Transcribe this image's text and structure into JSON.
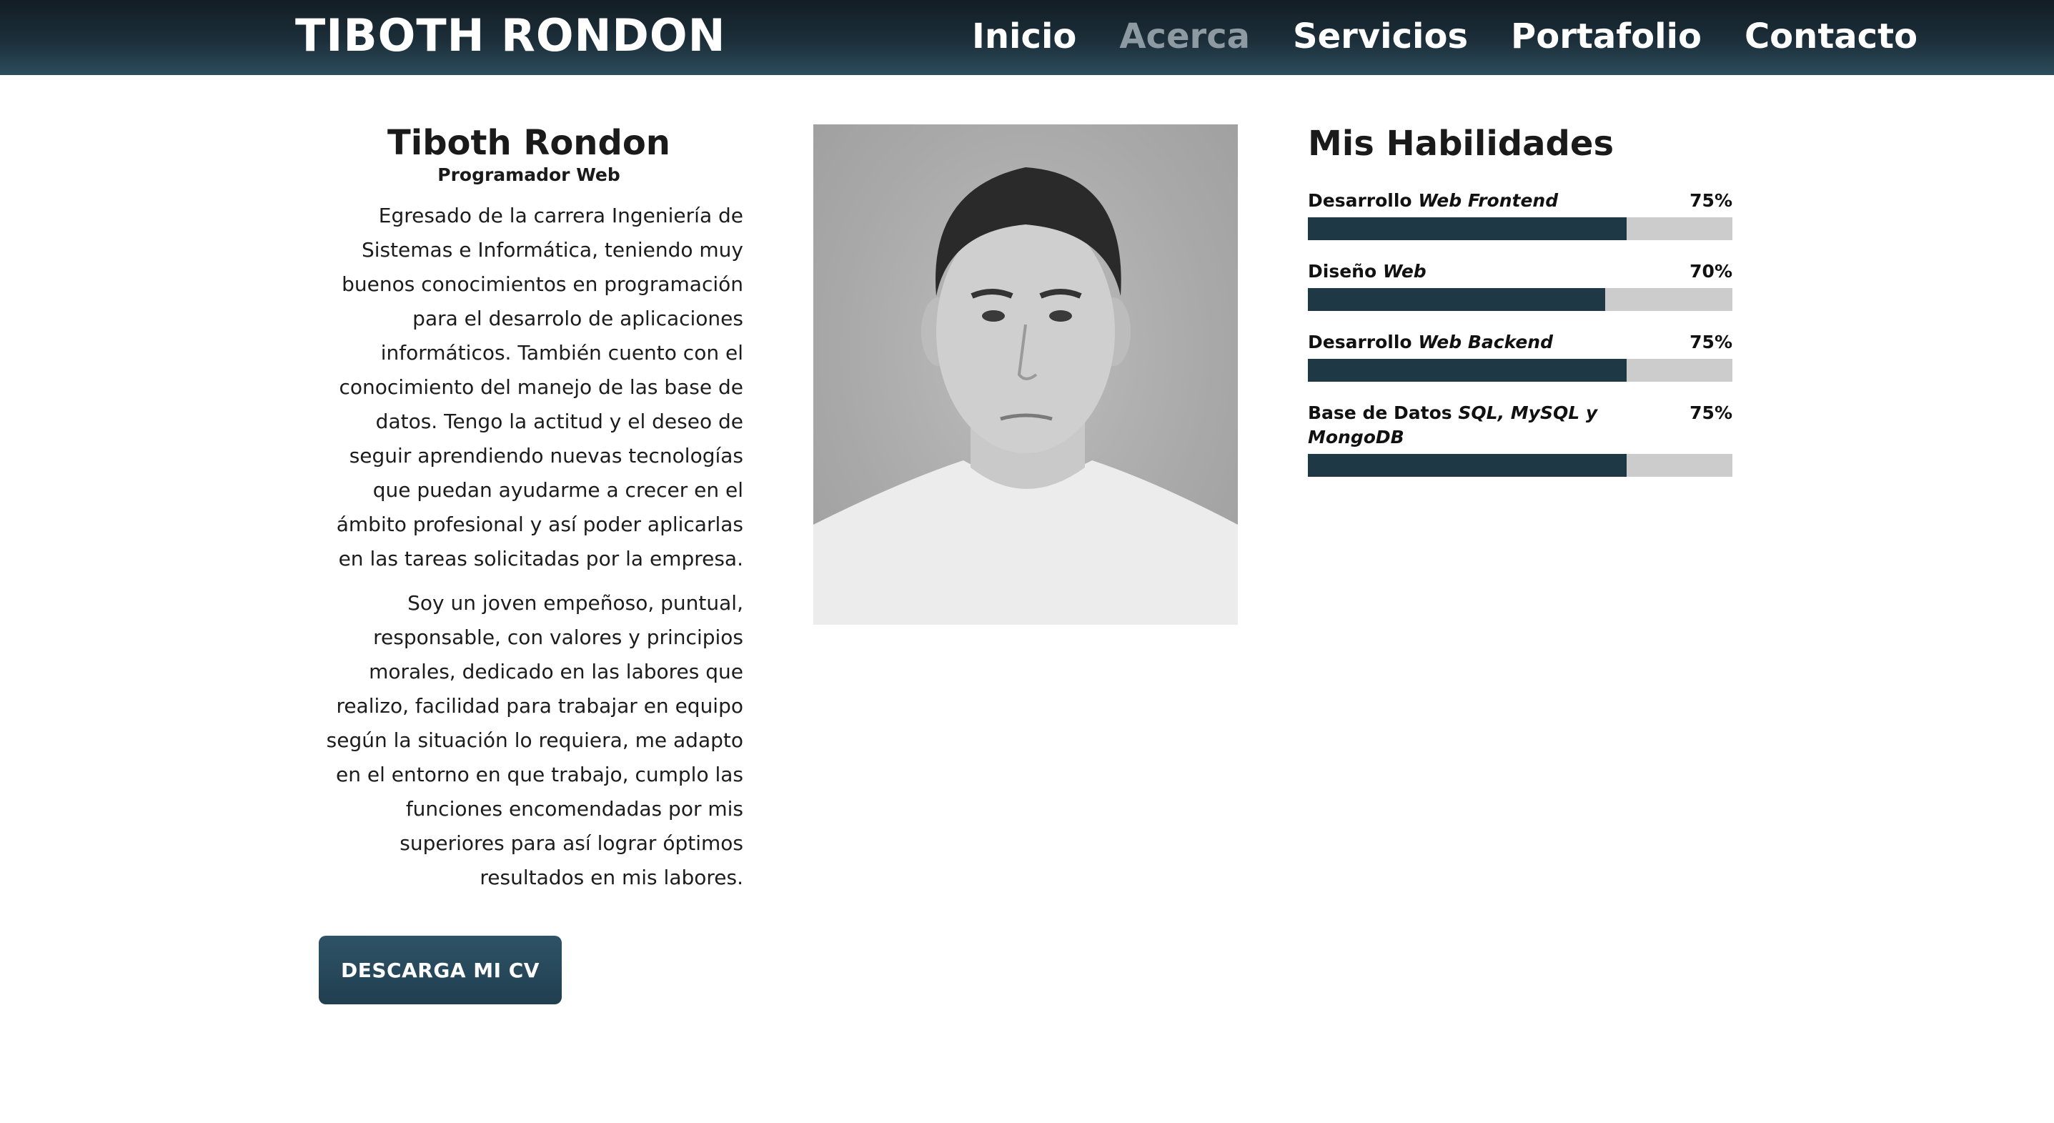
{
  "header": {
    "brand": "TIBOTH RONDON",
    "nav": [
      "Inicio",
      "Acerca",
      "Servicios",
      "Portafolio",
      "Contacto"
    ],
    "active_nav": "Acerca"
  },
  "about": {
    "name": "Tiboth Rondon",
    "role": "Programador Web",
    "paragraph_1": "Egresado de la carrera Ingeniería de Sistemas e Informática, teniendo muy buenos conocimientos en programación para el desarrolo de aplicaciones informáticos. También cuento con el conocimiento del manejo de las base de datos. Tengo la actitud y el deseo de seguir aprendiendo nuevas tecnologías que puedan ayudarme a crecer en el ámbito profesional y así poder aplicarlas en las tareas solicitadas por la empresa.",
    "paragraph_2": "Soy un joven empeñoso, puntual, responsable, con valores y principios morales, dedicado en las labores que realizo, facilidad para trabajar en equipo según la situación lo requiera, me adapto en el entorno en que trabajo, cumplo las funciones encomendadas por mis superiores para así lograr óptimos resultados en mis labores.",
    "cv_button": "DESCARGA MI CV"
  },
  "skills": {
    "title": "Mis Habilidades",
    "items": [
      {
        "label": "Desarrollo",
        "label_em": "Web Frontend",
        "percent_text": "75%",
        "percent": 75
      },
      {
        "label": "Diseño",
        "label_em": "Web",
        "percent_text": "70%",
        "percent": 70
      },
      {
        "label": "Desarrollo",
        "label_em": "Web Backend",
        "percent_text": "75%",
        "percent": 75
      },
      {
        "label": "Base de Datos",
        "label_em": "SQL, MySQL y MongoDB",
        "percent_text": "75%",
        "percent": 75
      }
    ]
  },
  "colors": {
    "header_dark": "#131d24",
    "header_light": "#2c4c5c",
    "nav_active": "#8d9aa1",
    "bar_fill": "#1f3845",
    "bar_track": "#cccccc",
    "button": "#2e5366"
  }
}
